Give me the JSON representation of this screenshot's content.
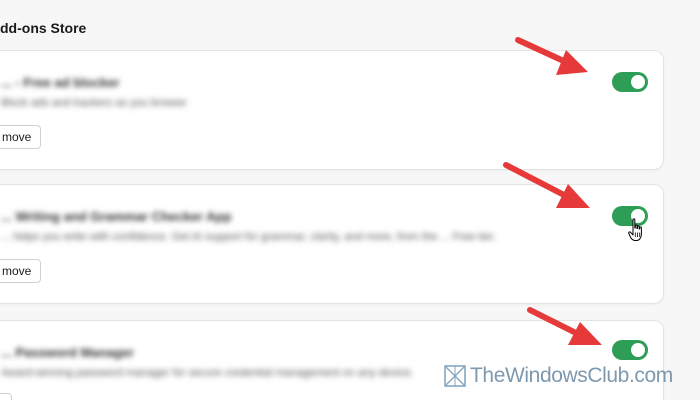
{
  "page": {
    "section_title": "dd-ons Store"
  },
  "extensions": [
    {
      "name": "... - Free ad blocker",
      "description": "Block ads and trackers as you browse",
      "remove_label": "move",
      "enabled": true
    },
    {
      "name": "... Writing and Grammar Checker App",
      "description": "... helps you write with confidence. Get AI support for grammar, clarity, and more, from the ... Free tier.",
      "remove_label": "move",
      "enabled": true
    },
    {
      "name": "... Password Manager",
      "description": "Award-winning password manager for secure credential management on any device.",
      "remove_label": "",
      "enabled": true
    }
  ],
  "annotations": {
    "arrow_color": "#e63a3a"
  },
  "watermark": {
    "text": "TheWindowsClub.com"
  },
  "colors": {
    "toggle_on": "#2e9e57",
    "card_bg": "#ffffff",
    "page_bg": "#f7f7f7"
  }
}
